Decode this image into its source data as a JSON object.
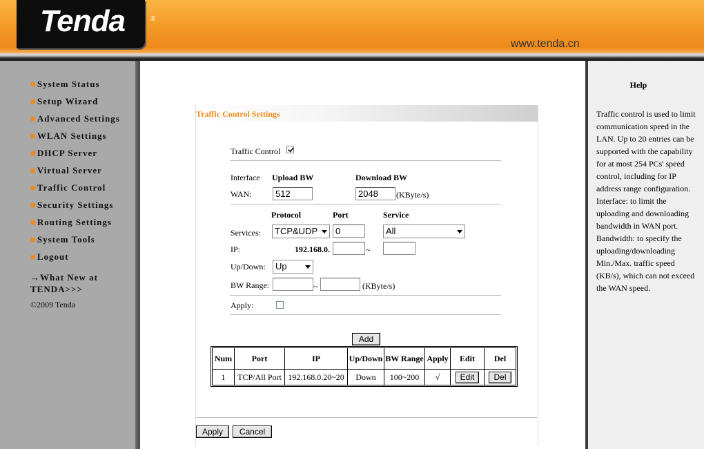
{
  "header": {
    "brand": "Tenda",
    "reg_mark": "®",
    "url": "www.tenda.cn"
  },
  "sidebar": {
    "items": [
      {
        "label": "System Status"
      },
      {
        "label": "Setup Wizard"
      },
      {
        "label": "Advanced Settings"
      },
      {
        "label": "WLAN Settings"
      },
      {
        "label": "DHCP Server"
      },
      {
        "label": "Virtual Server"
      },
      {
        "label": "Traffic Control"
      },
      {
        "label": "Security Settings"
      },
      {
        "label": "Routing Settings"
      },
      {
        "label": "System Tools"
      },
      {
        "label": "Logout"
      }
    ],
    "whats_new_line1": "→What New at",
    "whats_new_line2": "TENDA>>>",
    "copyright": "©2009 Tenda"
  },
  "panel": {
    "title": "Traffic Control Settings",
    "traffic_control_label": "Traffic Control",
    "traffic_control_enabled": true,
    "interface_label": "Interface",
    "upload_bw_label": "Upload BW",
    "download_bw_label": "Download BW",
    "wan_label": "WAN:",
    "upload_bw_value": "512",
    "download_bw_value": "2048",
    "kbytes_unit": "(KByte/s)",
    "protocol_label": "Protocol",
    "port_label": "Port",
    "service_label": "Service",
    "services_label": "Services:",
    "protocol_value": "TCP&UDP",
    "port_value": "0",
    "service_value": "All",
    "ip_label": "IP:",
    "ip_prefix": "192.168.0.",
    "ip_start": "",
    "ip_end": "",
    "tilde": "~",
    "updown_label": "Up/Down:",
    "updown_value": "Up",
    "bw_range_label": "BW Range:",
    "bw_range_min": "",
    "bw_range_max": "",
    "apply_label": "Apply:",
    "apply_checked": false,
    "add_button": "Add",
    "apply_button": "Apply",
    "cancel_button": "Cancel"
  },
  "rules_table": {
    "headers": [
      "Num",
      "Port",
      "IP",
      "Up/Down",
      "BW Range",
      "Apply",
      "Edit",
      "Del"
    ],
    "rows": [
      {
        "num": "1",
        "port": "TCP/All Port",
        "ip": "192.168.0.20~20",
        "updown": "Down",
        "bw_range": "100~200",
        "apply": "√",
        "edit": "Edit",
        "del": "Del"
      }
    ]
  },
  "help": {
    "title": "Help",
    "body": "Traffic control is used to limit communication speed in the LAN. Up to 20 entries can be supported with the capability for at most 254 PCs' speed control, including for IP address range configuration. Interface: to limit the uploading and downloading bandwidth in WAN port. Bandwidth: to specify the uploading/downloading Min./Max. traffic speed (KB/s), which can not exceed the WAN speed."
  }
}
